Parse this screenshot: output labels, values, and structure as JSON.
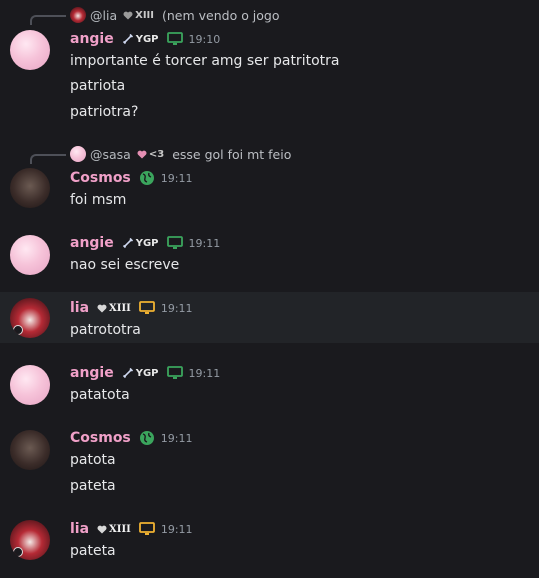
{
  "colors": {
    "background": "#1a1a1e",
    "username_pink": "#f0a0c8",
    "text": "#e6e7e9",
    "timestamp": "#949ba4",
    "highlight": "#222428"
  },
  "messages": {
    "m1": {
      "reply": {
        "name": "@lia",
        "tag": "XIII",
        "text": "(nem vendo o jogo"
      },
      "author": "angie",
      "tag": "YGP",
      "platform_icon": "desktop-icon",
      "time": "19:10",
      "lines": [
        "importante é torcer amg ser patritotra",
        "patriota",
        "patriotra?"
      ]
    },
    "m2": {
      "reply": {
        "name": "@sasa",
        "tag": "<3",
        "text": "esse gol foi mt feio"
      },
      "author": "Cosmos",
      "platform_icon": "globe-icon",
      "time": "19:11",
      "lines": [
        "foi msm"
      ]
    },
    "m3": {
      "author": "angie",
      "tag": "YGP",
      "platform_icon": "desktop-icon",
      "time": "19:11",
      "lines": [
        "nao sei escreve"
      ]
    },
    "m4": {
      "author": "lia",
      "tag": "XIII",
      "platform_icon": "desktop-icon",
      "time": "19:11",
      "lines": [
        "patrototra"
      ]
    },
    "m5": {
      "author": "angie",
      "tag": "YGP",
      "platform_icon": "desktop-icon",
      "time": "19:11",
      "lines": [
        "patatota"
      ]
    },
    "m6": {
      "author": "Cosmos",
      "platform_icon": "globe-icon",
      "time": "19:11",
      "lines": [
        "patota",
        "pateta"
      ]
    },
    "m7": {
      "author": "lia",
      "tag": "XIII",
      "platform_icon": "desktop-icon",
      "time": "19:11",
      "lines": [
        "pateta"
      ]
    }
  }
}
